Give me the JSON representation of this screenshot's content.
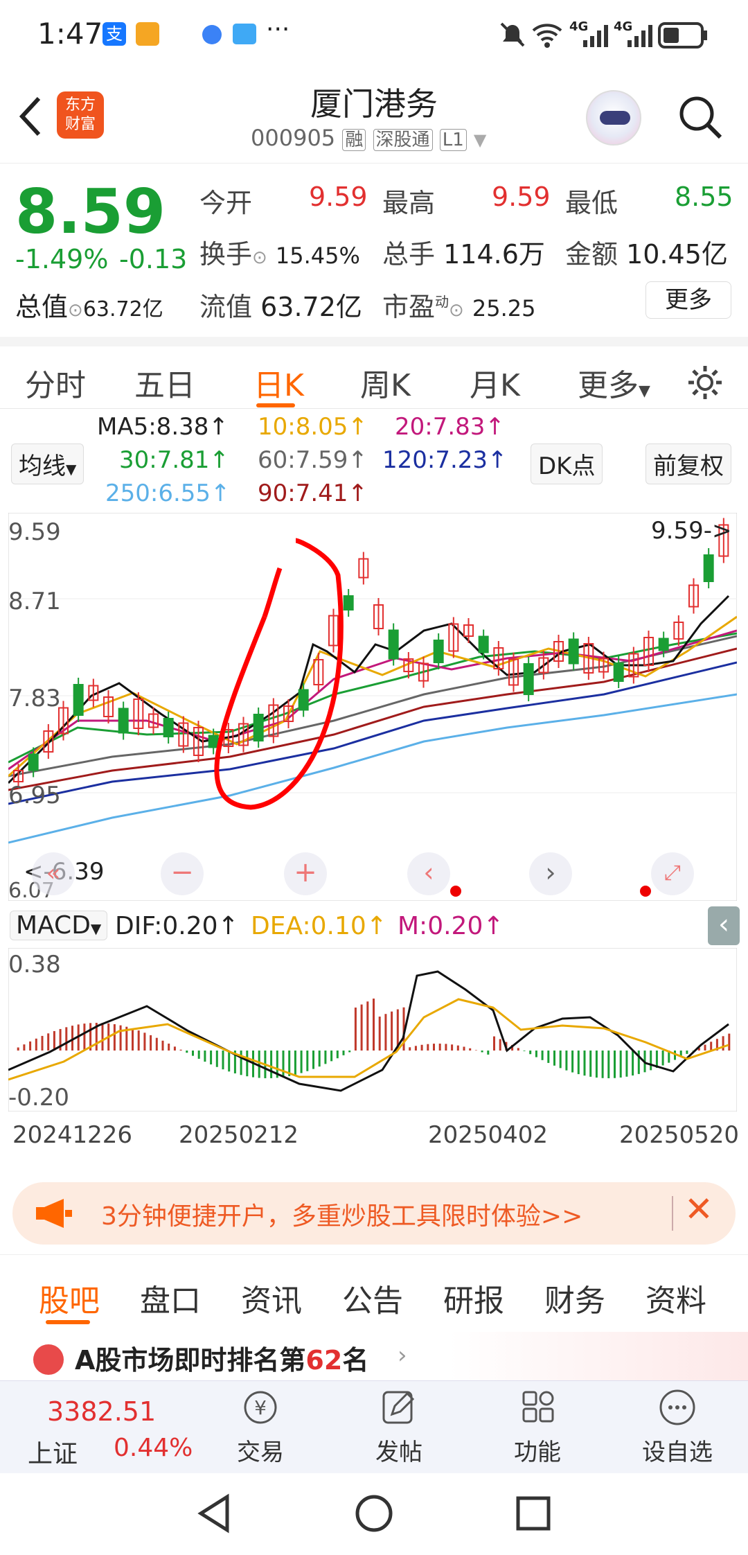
{
  "status": {
    "time": "1:47",
    "more": "···",
    "net1": "4G",
    "net2": "4G"
  },
  "header": {
    "badge_line1": "东方",
    "badge_line2": "财富",
    "title": "厦门港务",
    "code": "000905",
    "tag1": "融",
    "tag2": "深股通",
    "tag3": "L1"
  },
  "quote": {
    "price": "8.59",
    "pct": "-1.49%",
    "chg": "-0.13",
    "open_l": "今开",
    "open_v": "9.59",
    "high_l": "最高",
    "high_v": "9.59",
    "low_l": "最低",
    "low_v": "8.55",
    "turn_l": "换手",
    "turn_v": "15.45%",
    "vol_l": "总手",
    "vol_v": "114.6万",
    "amt_l": "金额",
    "amt_v": "10.45亿",
    "mcap_l": "总值",
    "mcap_v": "63.72亿",
    "float_l": "流值",
    "float_v": "63.72亿",
    "pe_l": "市盈",
    "pe_sup": "动",
    "pe_v": "25.25",
    "more": "更多"
  },
  "periods": [
    "分时",
    "五日",
    "日K",
    "周K",
    "月K",
    "更多"
  ],
  "ma": {
    "selector": "均线",
    "ma5": "MA5:8.38↑",
    "ma10": "10:8.05↑",
    "ma20": "20:7.83↑",
    "ma30": "30:7.81↑",
    "ma60": "60:7.59↑",
    "ma120": "120:7.23↑",
    "ma250": "250:6.55↑",
    "ma90": "90:7.41↑",
    "dk": "DK点",
    "fq": "前复权"
  },
  "chart": {
    "y1": "9.59",
    "y2": "8.71",
    "y3": "7.83",
    "y4": "6.95",
    "y5": "6.07",
    "maxlabel": "9.59->",
    "minlabel": "<-6.39"
  },
  "macd": {
    "name": "MACD",
    "dif": "DIF:0.20↑",
    "dea": "DEA:0.10↑",
    "m": "M:0.20↑",
    "top": "0.38",
    "bottom": "-0.20"
  },
  "dates": [
    "20241226",
    "20250212",
    "20250402",
    "20250520"
  ],
  "banner": {
    "text": "3分钟便捷开户，多重炒股工具限时体验>>"
  },
  "tabs": [
    "股吧",
    "盘口",
    "资讯",
    "公告",
    "研报",
    "财务",
    "资料"
  ],
  "news": {
    "prefix": "A股市场即时排名第",
    "rank": "62",
    "suffix": "名"
  },
  "bottomnav": {
    "index_value": "3382.51",
    "index_name": "上证",
    "index_pct": "0.44%",
    "trade": "交易",
    "post": "发帖",
    "func": "功能",
    "fav": "设自选"
  },
  "colors": {
    "up": "#e23030",
    "down": "#1a9e34",
    "accent": "#ff6600",
    "annotation": "#ff0000"
  }
}
